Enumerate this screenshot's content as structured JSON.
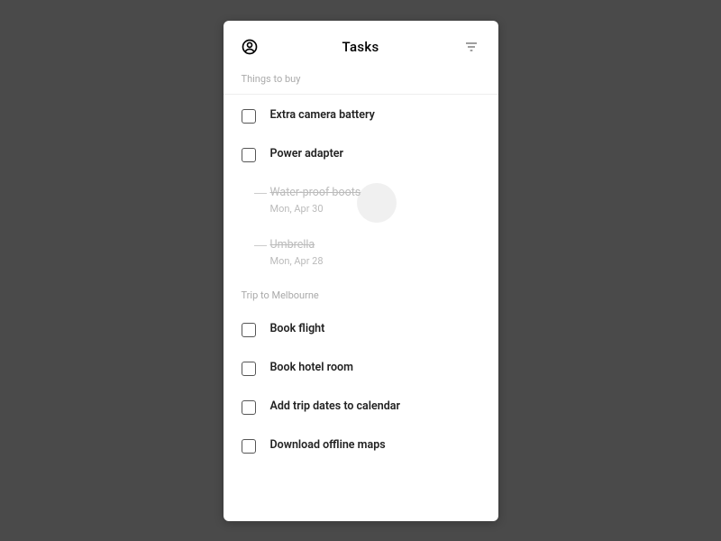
{
  "header": {
    "title": "Tasks"
  },
  "sections": [
    {
      "title": "Things to buy",
      "tasks": [
        {
          "label": "Extra camera battery",
          "completed": false
        },
        {
          "label": "Power adapter",
          "completed": false
        },
        {
          "label": "Water-proof boots",
          "completed": true,
          "date": "Mon, Apr 30"
        },
        {
          "label": "Umbrella",
          "completed": true,
          "date": "Mon, Apr 28"
        }
      ]
    },
    {
      "title": "Trip to Melbourne",
      "tasks": [
        {
          "label": "Book flight",
          "completed": false
        },
        {
          "label": "Book hotel room",
          "completed": false
        },
        {
          "label": "Add trip dates to calendar",
          "completed": false
        },
        {
          "label": "Download offline maps",
          "completed": false
        }
      ]
    }
  ]
}
